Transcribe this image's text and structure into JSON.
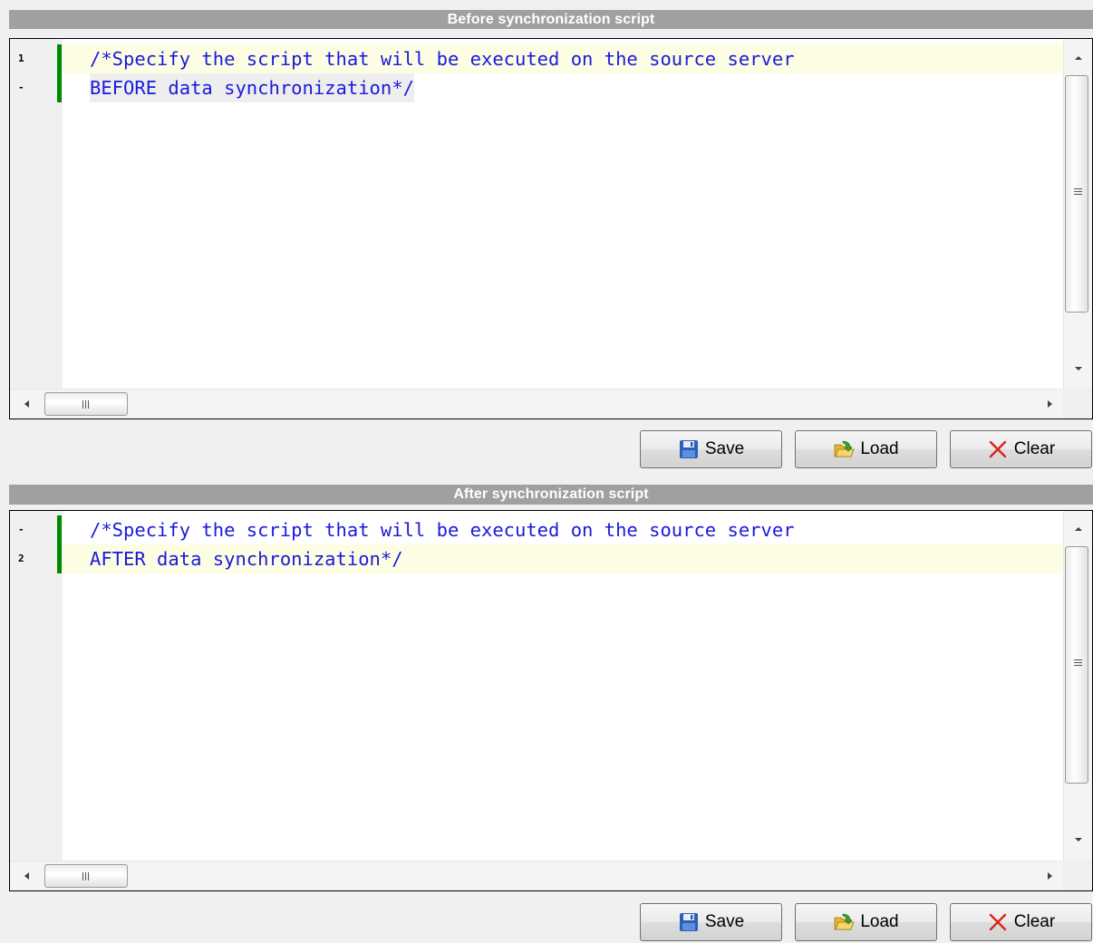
{
  "before": {
    "title": "Before synchronization script",
    "line_numbers": [
      "1",
      "-"
    ],
    "code_lines": [
      "/*Specify the script that will be executed on the source server",
      "BEFORE data synchronization*/"
    ],
    "buttons": {
      "save": "Save",
      "load": "Load",
      "clear": "Clear"
    },
    "hscroll_grip": "III"
  },
  "after": {
    "title": "After synchronization script",
    "line_numbers": [
      "-",
      "2"
    ],
    "code_lines": [
      "/*Specify the script that will be executed on the source server",
      "AFTER data synchronization*/"
    ],
    "buttons": {
      "save": "Save",
      "load": "Load",
      "clear": "Clear"
    },
    "hscroll_grip": "III"
  },
  "icons": {
    "save": "floppy-disk-icon",
    "load": "open-folder-icon",
    "clear": "red-x-icon"
  },
  "colors": {
    "title_bar": "#a0a0a0",
    "code_text": "#1a1adc",
    "change_marker": "#008a00",
    "current_line": "#fdfde3"
  }
}
